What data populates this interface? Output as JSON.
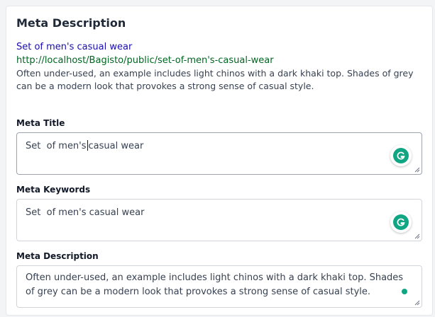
{
  "section": {
    "title": "Meta Description"
  },
  "preview": {
    "title": "Set of men's casual wear",
    "url": "http://localhost/Bagisto/public/set-of-men's-casual-wear",
    "description_line1": "Often under-used, an example includes light chinos with a dark khaki top. Shades of grey",
    "description_line2": "can be a modern look that provokes a strong sense of casual style."
  },
  "meta_title": {
    "label": "Meta Title",
    "value_before_caret": "Set  of men's",
    "value_after_caret": "casual wear"
  },
  "meta_keywords": {
    "label": "Meta Keywords",
    "value": "Set  of men's casual wear"
  },
  "meta_description": {
    "label": "Meta Description",
    "value": "Often under-used, an example includes light chinos with a dark khaki top. Shades of grey can be a modern look that provokes a strong sense of casual style."
  },
  "colors": {
    "preview_title": "#1a0dab",
    "preview_url": "#006621",
    "grammarly": "#11a683"
  },
  "icons": {
    "grammarly": "grammarly-icon",
    "resize": "resize-handle-icon"
  }
}
